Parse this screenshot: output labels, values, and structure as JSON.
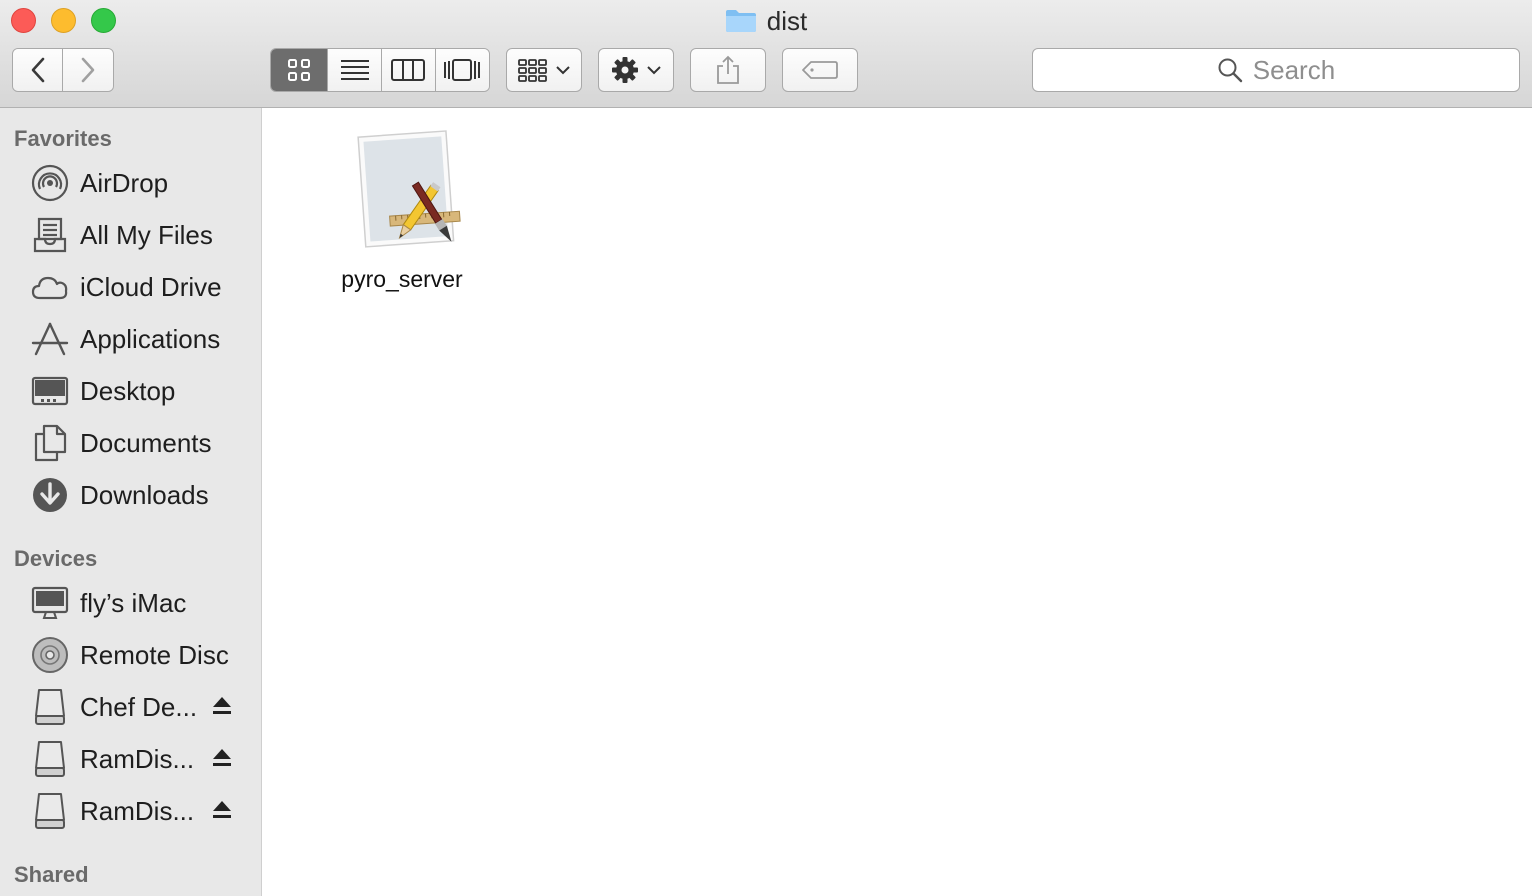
{
  "window": {
    "title": "dist"
  },
  "toolbar": {
    "back_icon": "chevron-left-icon",
    "forward_icon": "chevron-right-icon",
    "views": [
      "icon-view",
      "list-view",
      "column-view",
      "cover-flow-view"
    ],
    "active_view": "icon-view",
    "group_icon": "arrange-grid-icon",
    "action_icon": "gear-icon",
    "share_icon": "share-icon",
    "tag_icon": "tag-icon",
    "search_placeholder": "Search"
  },
  "sidebar": {
    "favorites_header": "Favorites",
    "favorites": [
      {
        "label": "AirDrop",
        "icon": "airdrop-icon"
      },
      {
        "label": "All My Files",
        "icon": "all-files-icon"
      },
      {
        "label": "iCloud Drive",
        "icon": "cloud-icon"
      },
      {
        "label": "Applications",
        "icon": "applications-icon"
      },
      {
        "label": "Desktop",
        "icon": "desktop-icon"
      },
      {
        "label": "Documents",
        "icon": "documents-icon"
      },
      {
        "label": "Downloads",
        "icon": "downloads-icon"
      }
    ],
    "devices_header": "Devices",
    "devices": [
      {
        "label": "fly’s iMac",
        "icon": "imac-icon",
        "eject": false
      },
      {
        "label": "Remote Disc",
        "icon": "disc-icon",
        "eject": false
      },
      {
        "label": "Chef De...",
        "icon": "drive-icon",
        "eject": true
      },
      {
        "label": "RamDis...",
        "icon": "drive-icon",
        "eject": true
      },
      {
        "label": "RamDis...",
        "icon": "drive-icon",
        "eject": true
      }
    ],
    "shared_header": "Shared"
  },
  "files": [
    {
      "name": "pyro_server",
      "icon": "application-bundle-icon"
    }
  ]
}
